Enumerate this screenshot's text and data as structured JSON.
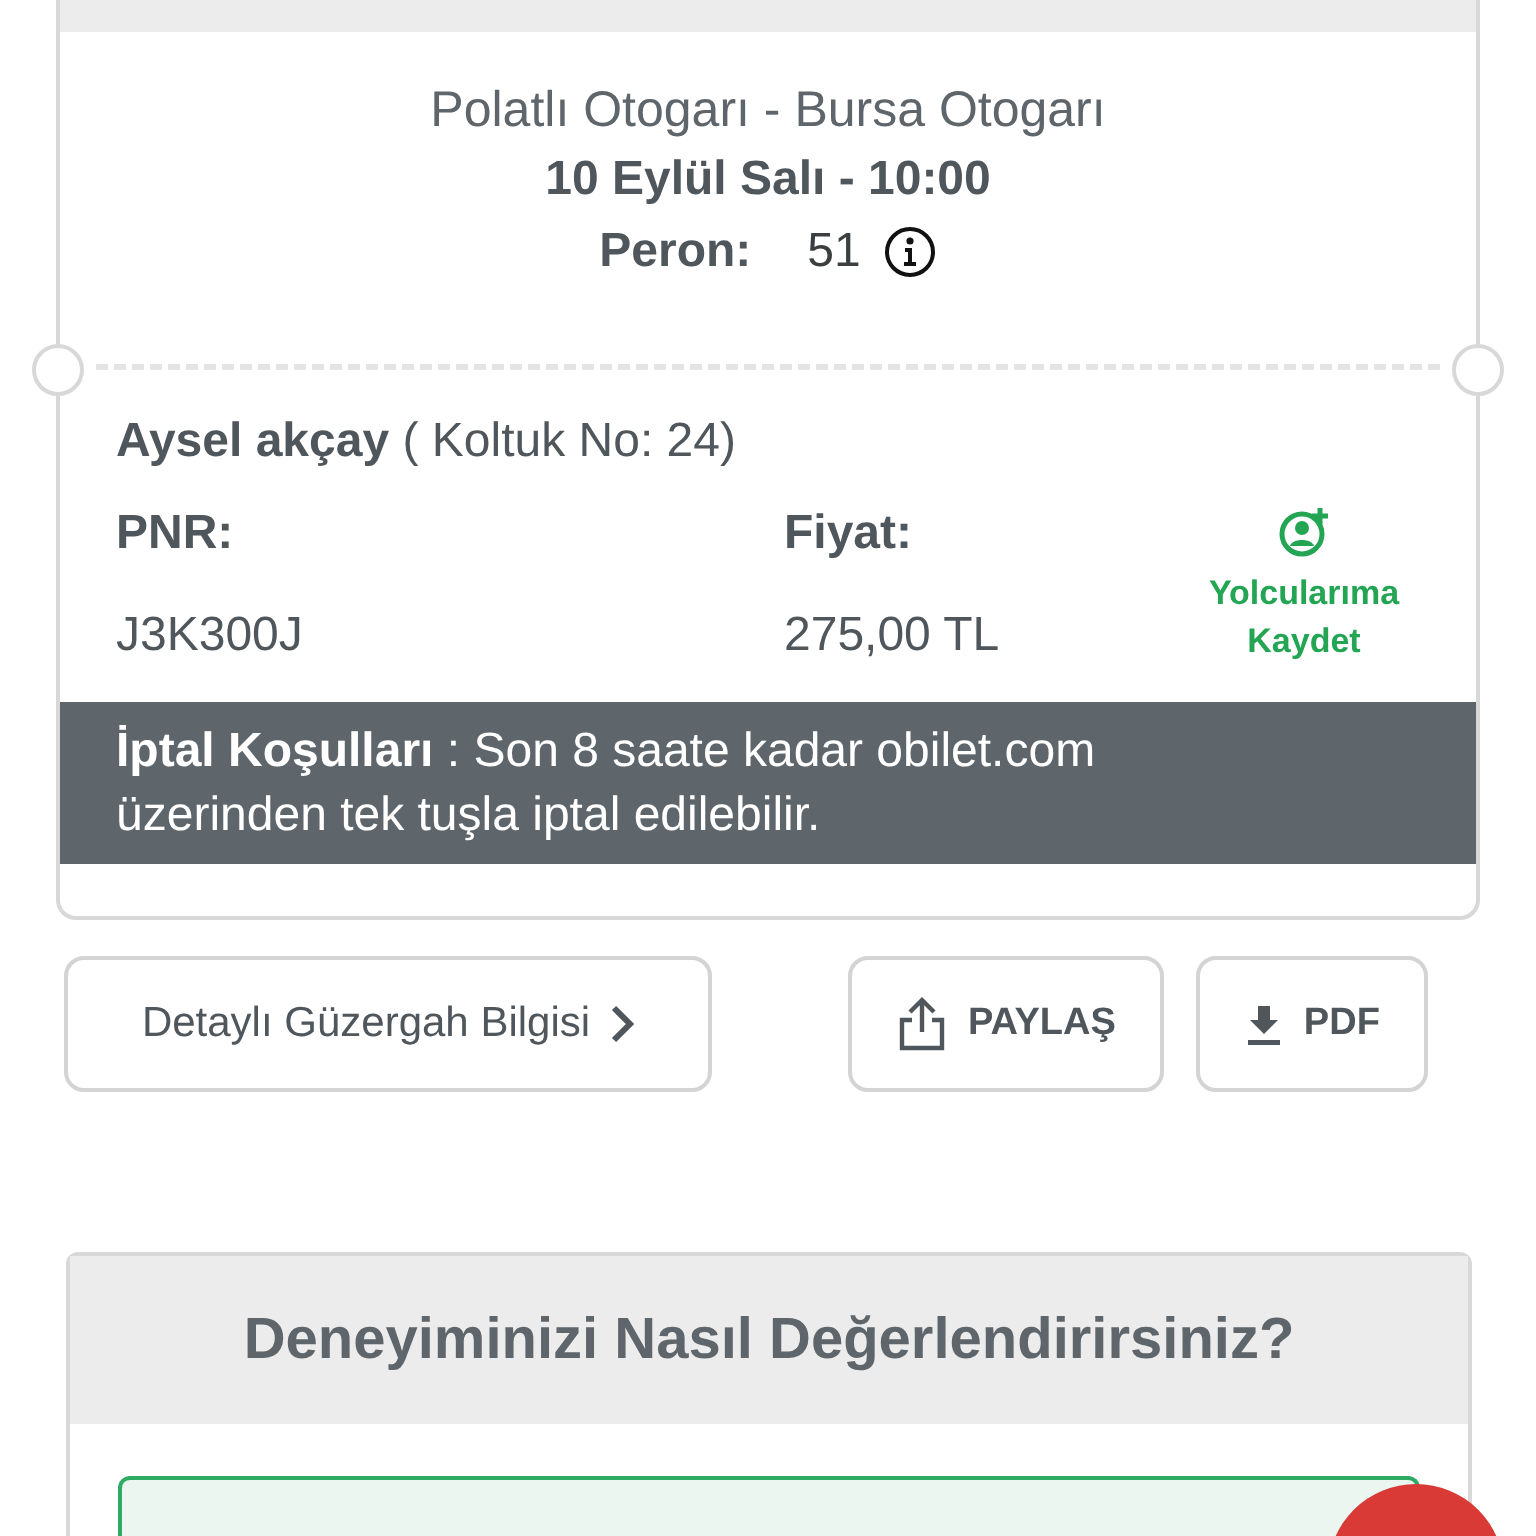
{
  "ticket": {
    "route": "Polatlı Otogarı - Bursa Otogarı",
    "datetime": "10 Eylül Salı - 10:00",
    "platform_label": "Peron:",
    "platform": "51",
    "passenger": "**Aysel akçay** ( Koltuk No: 24)",
    "pnr_label": "PNR:",
    "pnr": "J3K300J",
    "price_label": "Fiyat:",
    "price": "275,00 TL",
    "save_passenger": "Yolcularıma Kaydet",
    "cancellation": "**İptal Koşulları** : Son 8 saate kadar obilet.com üzerinden tek tuşla iptal edilebilir."
  },
  "actions": [
    {
      "kind": "link",
      "label": "Detaylı Güzergah Bilgisi"
    },
    {
      "kind": "share",
      "label": "PAYLAŞ"
    },
    {
      "kind": "download",
      "label": "PDF"
    }
  ],
  "rating": {
    "title": "Deneyiminizi Nasıl Değerlendirirsiniz?"
  }
}
